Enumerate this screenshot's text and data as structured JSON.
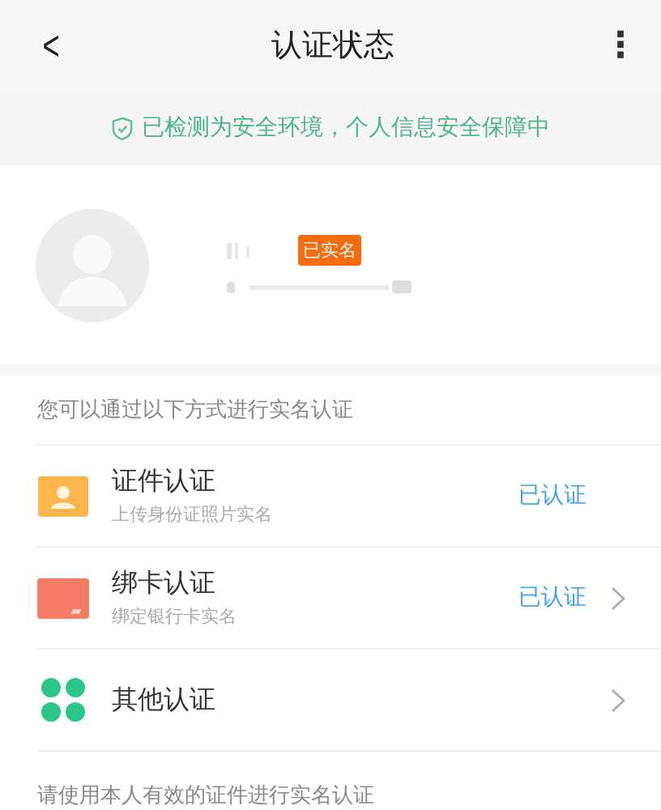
{
  "header": {
    "back": "<",
    "title": "认证状态",
    "more": "⋮"
  },
  "banner": {
    "text": "已检测为安全环境，个人信息安全保障中"
  },
  "profile": {
    "badge": "已实名"
  },
  "section_title": "您可以通过以下方式进行实名认证",
  "methods": [
    {
      "kind": "id",
      "title": "证件认证",
      "subtitle": "上传身份证照片实名",
      "status": "已认证",
      "chevron": false
    },
    {
      "kind": "card",
      "title": "绑卡认证",
      "subtitle": "绑定银行卡实名",
      "status": "已认证",
      "chevron": true
    },
    {
      "kind": "other",
      "title": "其他认证",
      "chevron": true
    }
  ],
  "footer_note": "请使用本人有效的证件进行实名认证"
}
